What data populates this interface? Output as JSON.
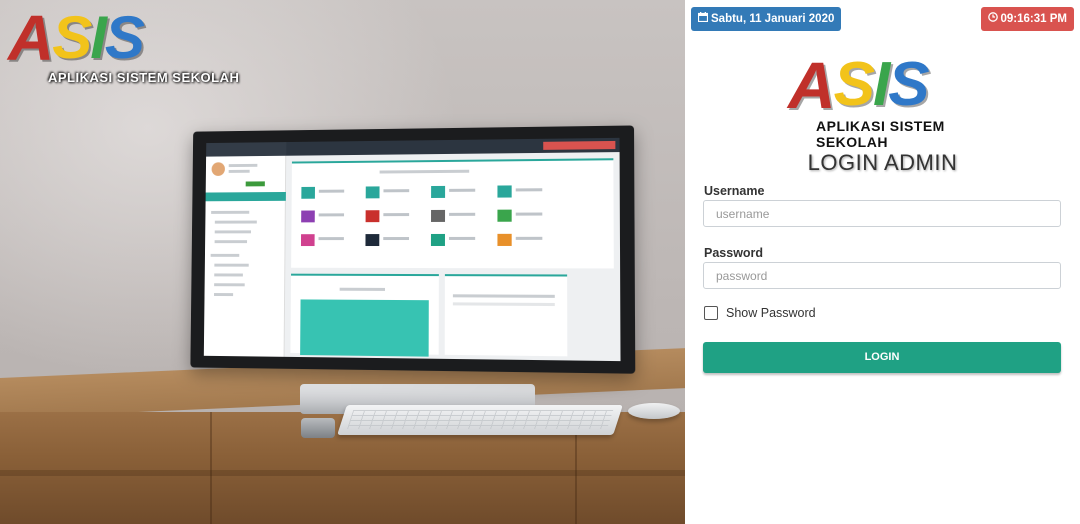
{
  "brand": {
    "logo_letters": [
      "A",
      "S",
      "I",
      "S"
    ],
    "tagline": "APLIKASI SISTEM SEKOLAH",
    "colors": {
      "a": "#c0302a",
      "s1": "#f2c31a",
      "i": "#3aa54c",
      "s2": "#2f78c8"
    }
  },
  "header": {
    "date_icon": "calendar-icon",
    "date": "Sabtu,  11 Januari  2020",
    "time_icon": "clock-icon",
    "time": "09:16:31 PM"
  },
  "login": {
    "title": "LOGIN ADMIN",
    "username_label": "Username",
    "username_placeholder": "username",
    "password_label": "Password",
    "password_placeholder": "password",
    "show_password_label": "Show Password",
    "submit_label": "LOGIN"
  },
  "colors": {
    "date_badge": "#337ab7",
    "time_badge": "#d9534f",
    "login_button": "#1fa184"
  }
}
